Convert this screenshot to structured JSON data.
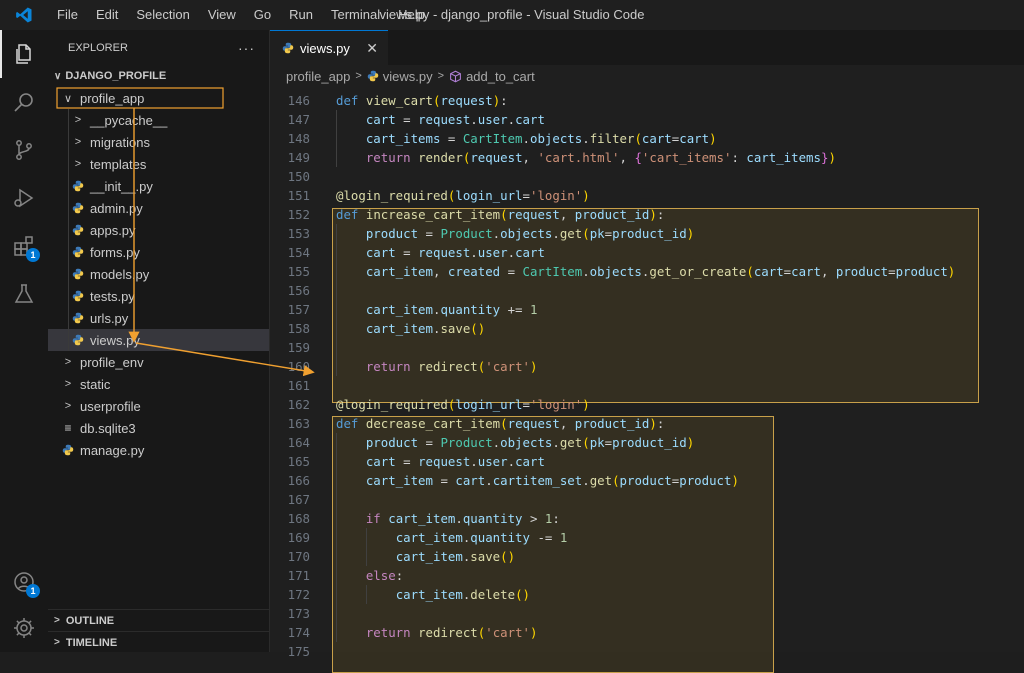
{
  "titlebar": {
    "menu": [
      "File",
      "Edit",
      "Selection",
      "View",
      "Go",
      "Run",
      "Terminal",
      "Help"
    ],
    "window_title": "views.py - django_profile - Visual Studio Code"
  },
  "activity_bar": {
    "items": [
      {
        "icon": "files-icon",
        "active": true
      },
      {
        "icon": "search-icon"
      },
      {
        "icon": "source-control-icon"
      },
      {
        "icon": "run-debug-icon"
      },
      {
        "icon": "extensions-icon",
        "badge": "1"
      },
      {
        "icon": "flask-icon"
      }
    ],
    "bottom": [
      {
        "icon": "account-icon",
        "badge": "1"
      },
      {
        "icon": "gear-icon"
      }
    ]
  },
  "sidebar": {
    "title": "EXPLORER",
    "more": "···",
    "project": "DJANGO_PROFILE",
    "tree": [
      {
        "label": "profile_app",
        "type": "folder-open",
        "depth": 1
      },
      {
        "label": "__pycache__",
        "type": "folder",
        "depth": 2
      },
      {
        "label": "migrations",
        "type": "folder",
        "depth": 2
      },
      {
        "label": "templates",
        "type": "folder",
        "depth": 2
      },
      {
        "label": "__init__.py",
        "type": "py",
        "depth": 2
      },
      {
        "label": "admin.py",
        "type": "py",
        "depth": 2
      },
      {
        "label": "apps.py",
        "type": "py",
        "depth": 2
      },
      {
        "label": "forms.py",
        "type": "py",
        "depth": 2
      },
      {
        "label": "models.py",
        "type": "py",
        "depth": 2
      },
      {
        "label": "tests.py",
        "type": "py",
        "depth": 2
      },
      {
        "label": "urls.py",
        "type": "py",
        "depth": 2
      },
      {
        "label": "views.py",
        "type": "py",
        "depth": 2,
        "selected": true
      },
      {
        "label": "profile_env",
        "type": "folder",
        "depth": 1
      },
      {
        "label": "static",
        "type": "folder",
        "depth": 1
      },
      {
        "label": "userprofile",
        "type": "folder",
        "depth": 1
      },
      {
        "label": "db.sqlite3",
        "type": "db",
        "depth": 1
      },
      {
        "label": "manage.py",
        "type": "py",
        "depth": 1
      }
    ],
    "outline": "OUTLINE",
    "timeline": "TIMELINE"
  },
  "editor": {
    "tab": {
      "label": "views.py",
      "close": "✕"
    },
    "breadcrumb": [
      "profile_app",
      "views.py",
      "add_to_cart"
    ]
  },
  "code_lines": [
    {
      "n": "146",
      "tokens": [
        [
          "kw",
          "def"
        ],
        [
          "op",
          " "
        ],
        [
          "fn",
          "view_cart"
        ],
        [
          "br1",
          "("
        ],
        [
          "var",
          "request"
        ],
        [
          "br1",
          ")"
        ],
        [
          "op",
          ":"
        ]
      ]
    },
    {
      "n": "147",
      "tokens": [
        [
          "op",
          "    "
        ],
        [
          "var",
          "cart"
        ],
        [
          "op",
          " = "
        ],
        [
          "var",
          "request"
        ],
        [
          "op",
          "."
        ],
        [
          "var",
          "user"
        ],
        [
          "op",
          "."
        ],
        [
          "var",
          "cart"
        ]
      ]
    },
    {
      "n": "148",
      "tokens": [
        [
          "op",
          "    "
        ],
        [
          "var",
          "cart_items"
        ],
        [
          "op",
          " = "
        ],
        [
          "cls",
          "CartItem"
        ],
        [
          "op",
          "."
        ],
        [
          "var",
          "objects"
        ],
        [
          "op",
          "."
        ],
        [
          "fn",
          "filter"
        ],
        [
          "br1",
          "("
        ],
        [
          "var",
          "cart"
        ],
        [
          "op",
          "="
        ],
        [
          "var",
          "cart"
        ],
        [
          "br1",
          ")"
        ]
      ]
    },
    {
      "n": "149",
      "tokens": [
        [
          "op",
          "    "
        ],
        [
          "kw2",
          "return"
        ],
        [
          "op",
          " "
        ],
        [
          "fn",
          "render"
        ],
        [
          "br1",
          "("
        ],
        [
          "var",
          "request"
        ],
        [
          "op",
          ", "
        ],
        [
          "str",
          "'cart.html'"
        ],
        [
          "op",
          ", "
        ],
        [
          "br2",
          "{"
        ],
        [
          "str",
          "'cart_items'"
        ],
        [
          "op",
          ": "
        ],
        [
          "var",
          "cart_items"
        ],
        [
          "br2",
          "}"
        ],
        [
          "br1",
          ")"
        ]
      ]
    },
    {
      "n": "150",
      "tokens": []
    },
    {
      "n": "151",
      "tokens": [
        [
          "fn",
          "@login_required"
        ],
        [
          "br1",
          "("
        ],
        [
          "var",
          "login_url"
        ],
        [
          "op",
          "="
        ],
        [
          "str",
          "'login'"
        ],
        [
          "br1",
          ")"
        ]
      ]
    },
    {
      "n": "152",
      "tokens": [
        [
          "kw",
          "def"
        ],
        [
          "op",
          " "
        ],
        [
          "fn",
          "increase_cart_item"
        ],
        [
          "br1",
          "("
        ],
        [
          "var",
          "request"
        ],
        [
          "op",
          ", "
        ],
        [
          "var",
          "product_id"
        ],
        [
          "br1",
          ")"
        ],
        [
          "op",
          ":"
        ]
      ]
    },
    {
      "n": "153",
      "tokens": [
        [
          "op",
          "    "
        ],
        [
          "var",
          "product"
        ],
        [
          "op",
          " = "
        ],
        [
          "cls",
          "Product"
        ],
        [
          "op",
          "."
        ],
        [
          "var",
          "objects"
        ],
        [
          "op",
          "."
        ],
        [
          "fn",
          "get"
        ],
        [
          "br1",
          "("
        ],
        [
          "var",
          "pk"
        ],
        [
          "op",
          "="
        ],
        [
          "var",
          "product_id"
        ],
        [
          "br1",
          ")"
        ]
      ]
    },
    {
      "n": "154",
      "tokens": [
        [
          "op",
          "    "
        ],
        [
          "var",
          "cart"
        ],
        [
          "op",
          " = "
        ],
        [
          "var",
          "request"
        ],
        [
          "op",
          "."
        ],
        [
          "var",
          "user"
        ],
        [
          "op",
          "."
        ],
        [
          "var",
          "cart"
        ]
      ]
    },
    {
      "n": "155",
      "tokens": [
        [
          "op",
          "    "
        ],
        [
          "var",
          "cart_item"
        ],
        [
          "op",
          ", "
        ],
        [
          "var",
          "created"
        ],
        [
          "op",
          " = "
        ],
        [
          "cls",
          "CartItem"
        ],
        [
          "op",
          "."
        ],
        [
          "var",
          "objects"
        ],
        [
          "op",
          "."
        ],
        [
          "fn",
          "get_or_create"
        ],
        [
          "br1",
          "("
        ],
        [
          "var",
          "cart"
        ],
        [
          "op",
          "="
        ],
        [
          "var",
          "cart"
        ],
        [
          "op",
          ", "
        ],
        [
          "var",
          "product"
        ],
        [
          "op",
          "="
        ],
        [
          "var",
          "product"
        ],
        [
          "br1",
          ")"
        ]
      ]
    },
    {
      "n": "156",
      "tokens": []
    },
    {
      "n": "157",
      "tokens": [
        [
          "op",
          "    "
        ],
        [
          "var",
          "cart_item"
        ],
        [
          "op",
          "."
        ],
        [
          "var",
          "quantity"
        ],
        [
          "op",
          " += "
        ],
        [
          "num",
          "1"
        ]
      ]
    },
    {
      "n": "158",
      "tokens": [
        [
          "op",
          "    "
        ],
        [
          "var",
          "cart_item"
        ],
        [
          "op",
          "."
        ],
        [
          "fn",
          "save"
        ],
        [
          "br1",
          "()"
        ]
      ]
    },
    {
      "n": "159",
      "tokens": []
    },
    {
      "n": "160",
      "tokens": [
        [
          "op",
          "    "
        ],
        [
          "kw2",
          "return"
        ],
        [
          "op",
          " "
        ],
        [
          "fn",
          "redirect"
        ],
        [
          "br1",
          "("
        ],
        [
          "str",
          "'cart'"
        ],
        [
          "br1",
          ")"
        ]
      ]
    },
    {
      "n": "161",
      "tokens": []
    },
    {
      "n": "162",
      "tokens": [
        [
          "fn",
          "@login_required"
        ],
        [
          "br1",
          "("
        ],
        [
          "var",
          "login_url"
        ],
        [
          "op",
          "="
        ],
        [
          "str",
          "'login'"
        ],
        [
          "br1",
          ")"
        ]
      ]
    },
    {
      "n": "163",
      "tokens": [
        [
          "kw",
          "def"
        ],
        [
          "op",
          " "
        ],
        [
          "fn",
          "decrease_cart_item"
        ],
        [
          "br1",
          "("
        ],
        [
          "var",
          "request"
        ],
        [
          "op",
          ", "
        ],
        [
          "var",
          "product_id"
        ],
        [
          "br1",
          ")"
        ],
        [
          "op",
          ":"
        ]
      ]
    },
    {
      "n": "164",
      "tokens": [
        [
          "op",
          "    "
        ],
        [
          "var",
          "product"
        ],
        [
          "op",
          " = "
        ],
        [
          "cls",
          "Product"
        ],
        [
          "op",
          "."
        ],
        [
          "var",
          "objects"
        ],
        [
          "op",
          "."
        ],
        [
          "fn",
          "get"
        ],
        [
          "br1",
          "("
        ],
        [
          "var",
          "pk"
        ],
        [
          "op",
          "="
        ],
        [
          "var",
          "product_id"
        ],
        [
          "br1",
          ")"
        ]
      ]
    },
    {
      "n": "165",
      "tokens": [
        [
          "op",
          "    "
        ],
        [
          "var",
          "cart"
        ],
        [
          "op",
          " = "
        ],
        [
          "var",
          "request"
        ],
        [
          "op",
          "."
        ],
        [
          "var",
          "user"
        ],
        [
          "op",
          "."
        ],
        [
          "var",
          "cart"
        ]
      ]
    },
    {
      "n": "166",
      "tokens": [
        [
          "op",
          "    "
        ],
        [
          "var",
          "cart_item"
        ],
        [
          "op",
          " = "
        ],
        [
          "var",
          "cart"
        ],
        [
          "op",
          "."
        ],
        [
          "var",
          "cartitem_set"
        ],
        [
          "op",
          "."
        ],
        [
          "fn",
          "get"
        ],
        [
          "br1",
          "("
        ],
        [
          "var",
          "product"
        ],
        [
          "op",
          "="
        ],
        [
          "var",
          "product"
        ],
        [
          "br1",
          ")"
        ]
      ]
    },
    {
      "n": "167",
      "tokens": []
    },
    {
      "n": "168",
      "tokens": [
        [
          "op",
          "    "
        ],
        [
          "kw2",
          "if"
        ],
        [
          "op",
          " "
        ],
        [
          "var",
          "cart_item"
        ],
        [
          "op",
          "."
        ],
        [
          "var",
          "quantity"
        ],
        [
          "op",
          " > "
        ],
        [
          "num",
          "1"
        ],
        [
          "op",
          ":"
        ]
      ]
    },
    {
      "n": "169",
      "tokens": [
        [
          "op",
          "        "
        ],
        [
          "var",
          "cart_item"
        ],
        [
          "op",
          "."
        ],
        [
          "var",
          "quantity"
        ],
        [
          "op",
          " -= "
        ],
        [
          "num",
          "1"
        ]
      ]
    },
    {
      "n": "170",
      "tokens": [
        [
          "op",
          "        "
        ],
        [
          "var",
          "cart_item"
        ],
        [
          "op",
          "."
        ],
        [
          "fn",
          "save"
        ],
        [
          "br1",
          "()"
        ]
      ]
    },
    {
      "n": "171",
      "tokens": [
        [
          "op",
          "    "
        ],
        [
          "kw2",
          "else"
        ],
        [
          "op",
          ":"
        ]
      ]
    },
    {
      "n": "172",
      "tokens": [
        [
          "op",
          "        "
        ],
        [
          "var",
          "cart_item"
        ],
        [
          "op",
          "."
        ],
        [
          "fn",
          "delete"
        ],
        [
          "br1",
          "()"
        ]
      ]
    },
    {
      "n": "173",
      "tokens": []
    },
    {
      "n": "174",
      "tokens": [
        [
          "op",
          "    "
        ],
        [
          "kw2",
          "return"
        ],
        [
          "op",
          " "
        ],
        [
          "fn",
          "redirect"
        ],
        [
          "br1",
          "("
        ],
        [
          "str",
          "'cart'"
        ],
        [
          "br1",
          ")"
        ]
      ]
    },
    {
      "n": "175",
      "tokens": []
    }
  ],
  "colors": {
    "accent": "#0078d4",
    "annotation": "#f0a030",
    "highlight_border": "#c8a04a"
  }
}
